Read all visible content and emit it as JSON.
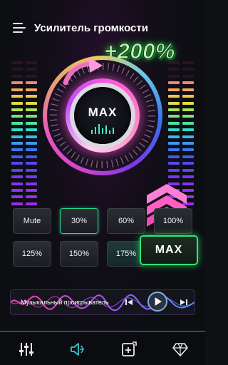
{
  "header": {
    "title": "Усилитель громкости",
    "menu_icon": "hamburger-menu-icon"
  },
  "boost_label": "+200%",
  "dial": {
    "label": "MAX"
  },
  "presets": [
    {
      "label": "Mute",
      "selected": false
    },
    {
      "label": "30%",
      "selected": true
    },
    {
      "label": "60%",
      "selected": false
    },
    {
      "label": "100%",
      "selected": false
    },
    {
      "label": "125%",
      "selected": false
    },
    {
      "label": "150%",
      "selected": false
    },
    {
      "label": "175%",
      "selected": false
    }
  ],
  "max_button": {
    "label": "MAX"
  },
  "player": {
    "label": "Музыкальный проигрыватель",
    "icons": [
      "prev-track-icon",
      "play-icon",
      "next-track-icon"
    ]
  },
  "bottom_nav": [
    "equalizer-icon",
    "volume-boost-icon",
    "add-shortcut-icon",
    "premium-diamond-icon"
  ],
  "colors": {
    "accent_green": "#2ee86e",
    "accent_pink": "#ff5ad8",
    "nav_active": "#36c6c9"
  }
}
